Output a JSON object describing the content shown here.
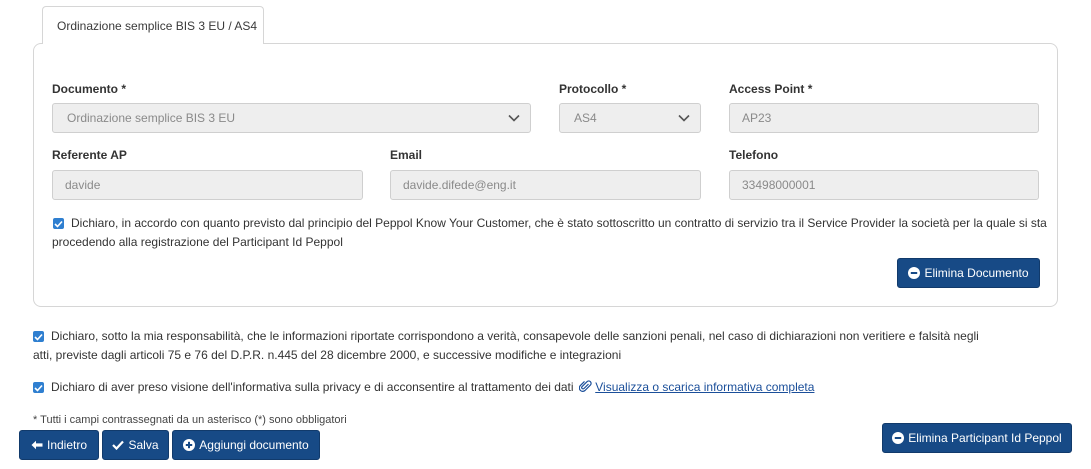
{
  "tab": {
    "label": "Ordinazione semplice BIS 3 EU / AS4"
  },
  "form": {
    "documento": {
      "label": "Documento *",
      "value": "Ordinazione semplice BIS 3 EU"
    },
    "protocollo": {
      "label": "Protocollo *",
      "value": "AS4"
    },
    "access_point": {
      "label": "Access Point *",
      "value": "AP23"
    },
    "referente": {
      "label": "Referente AP",
      "value": "davide"
    },
    "email": {
      "label": "Email",
      "value": "davide.difede@eng.it"
    },
    "telefono": {
      "label": "Telefono",
      "value": "33498000001"
    },
    "kyc_line1": "Dichiaro, in accordo con quanto previsto dal principio del Peppol Know Your Customer, che è stato sottoscritto un contratto di servizio tra il Service Provider la società per la quale si sta",
    "kyc_line2": "procedendo alla registrazione del Participant Id Peppol",
    "elimina_documento": "Elimina Documento"
  },
  "declarations": {
    "responsabilita_line1": "Dichiaro, sotto la mia responsabilità, che le informazioni riportate corrispondono a verità, consapevole delle sanzioni penali, nel caso di dichiarazioni non veritiere e falsità negli",
    "responsabilita_line2": "atti, previste dagli articoli 75 e 76 del D.P.R. n.445 del 28 dicembre 2000, e successive modifiche e integrazioni",
    "privacy_text": "Dichiaro di aver preso visione dell'informativa sulla privacy e di acconsentire al trattamento dei dati",
    "privacy_link": "Visualizza o scarica informativa completa"
  },
  "required_note": "* Tutti i campi contrassegnati da un asterisco (*) sono obbligatori",
  "buttons": {
    "indietro": "Indietro",
    "salva": "Salva",
    "aggiungi": "Aggiungi documento",
    "elimina_participant": "Elimina Participant Id Peppol"
  },
  "colors": {
    "primary": "#174a86",
    "checkbox": "#2f7fd0",
    "field_bg": "#eeeeee"
  }
}
